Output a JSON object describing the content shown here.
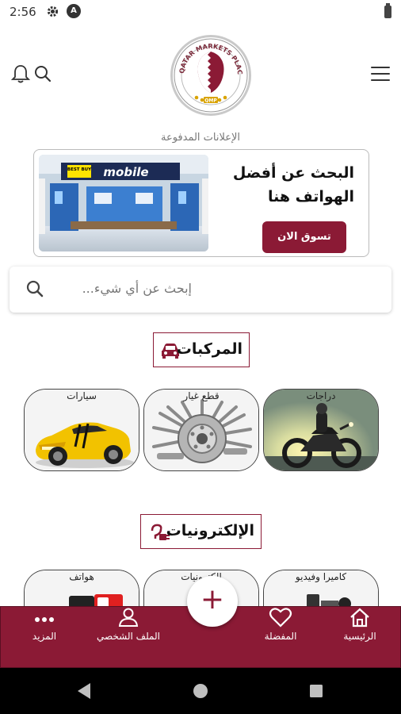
{
  "status_bar": {
    "time": "2:56",
    "icons": [
      "gear-icon",
      "a-badge-icon",
      "battery-icon"
    ]
  },
  "header": {
    "logo": {
      "top_text": "QATAR MARKETS PLACE",
      "bottom_text": "QMP",
      "icon": "qatar-flag-logo"
    },
    "icons": [
      "bell-icon",
      "search-icon",
      "hamburger-menu-icon"
    ]
  },
  "paid_ads_label": "الإعلانات المدفوعة",
  "banner": {
    "title": "البحث عن أفضل الهواتف هنا",
    "button_label": "تسوق الان",
    "image_sign_brand": "BEST BUY",
    "image_sign_text": "mobile"
  },
  "search": {
    "placeholder": "إبحث عن أي شيء..."
  },
  "sections": {
    "vehicles": {
      "title": "المركبات",
      "icon": "car-icon",
      "categories": [
        {
          "label": "سيارات",
          "icon": "sports-car-image"
        },
        {
          "label": "قطع غيار",
          "icon": "spare-parts-image"
        },
        {
          "label": "دراجات",
          "icon": "motorcycle-image"
        }
      ]
    },
    "electronics": {
      "title": "الإلكترونيات",
      "icon": "plug-icon",
      "categories": [
        {
          "label": "هواتف",
          "icon": "phones-image"
        },
        {
          "label": "الكترونيات",
          "icon": "electronics-image"
        },
        {
          "label": "كاميرا وفيديو",
          "icon": "camera-image"
        }
      ]
    }
  },
  "bottom_nav": {
    "items": [
      {
        "label": "المزيد",
        "icon": "more-dots-icon"
      },
      {
        "label": "الملف الشخصي",
        "icon": "profile-icon"
      },
      {
        "label": "المفضلة",
        "icon": "heart-icon"
      },
      {
        "label": "الرئيسية",
        "icon": "home-icon"
      }
    ],
    "fab": "+"
  },
  "colors": {
    "brand": "#8b1a35",
    "nav_background": "#8b1a35",
    "android_nav": "#000000"
  }
}
